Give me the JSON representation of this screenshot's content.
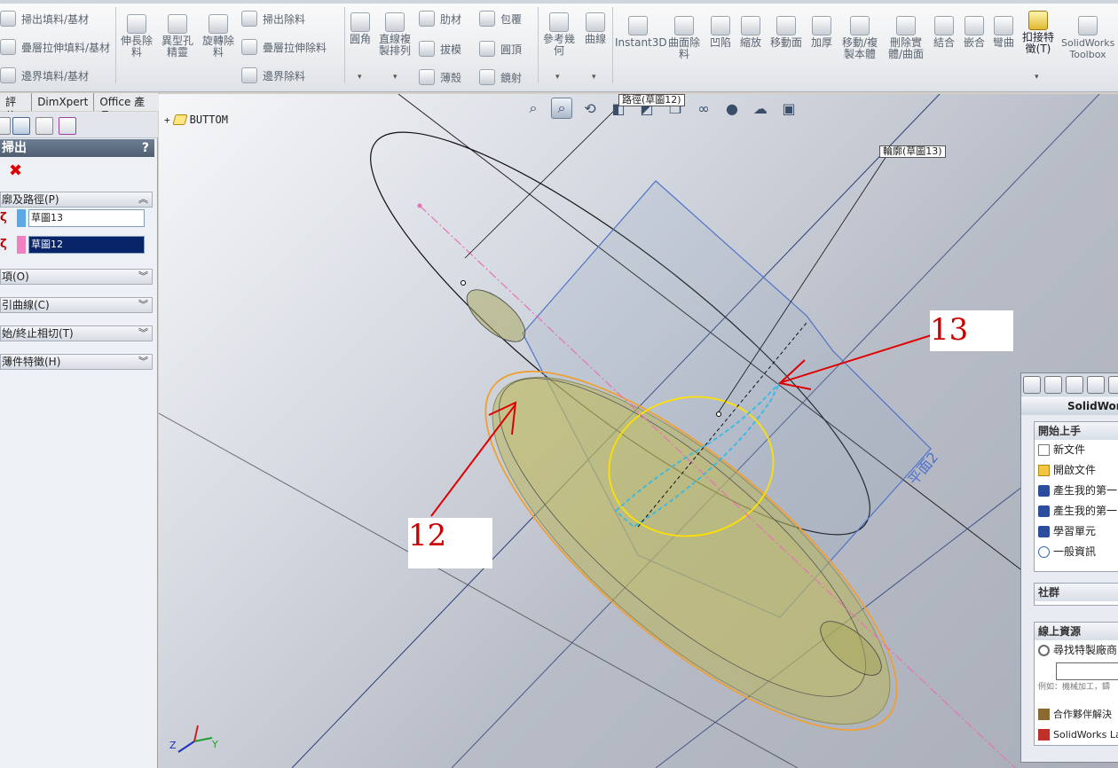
{
  "ribbon": {
    "sweep_boss": "掃出填料/基材",
    "loft_boss": "疊層拉伸填料/基材",
    "boundary_boss": "邊界填料/基材",
    "extrude_cut": "伸長除料",
    "hole_wizard": "異型孔精靈",
    "revolve_cut": "旋轉除料",
    "sweep_cut": "掃出除料",
    "loft_cut": "疊層拉伸除料",
    "boundary_cut": "邊界除料",
    "fillet": "圓角",
    "linear_pattern": "直線複製排列",
    "rib": "肋材",
    "draft": "拔模",
    "shell": "薄殼",
    "wrap": "包覆",
    "dome": "圓頂",
    "mirror": "鏡射",
    "reference_geometry": "參考幾何",
    "curves": "曲線",
    "instant3d": "Instant3D",
    "surface_cut": "曲面除料",
    "indent": "凹陷",
    "scale": "縮放",
    "move_face": "移動面",
    "thicken": "加厚",
    "move_copy_body": "移動/複製本體",
    "delete_body": "刪除實體/曲面",
    "combine": "結合",
    "intersect": "嵌合",
    "flex": "彎曲",
    "fastening_feature": "扣接特徵(T)",
    "toolbox": "SolidWorks Toolbox"
  },
  "tabs": [
    "評估",
    "DimXpert",
    "Office 產品"
  ],
  "property_manager": {
    "title": "掃出",
    "help": "?",
    "section_profile_path": "廓及路徑(P)",
    "profile_value": "草圖13",
    "path_value": "草圖12",
    "section_options": "項(O)",
    "section_guide_curves": "引曲線(C)",
    "section_start_end_tangency": "始/終止相切(T)",
    "section_thin_feature": "薄件特徵(H)"
  },
  "viewport": {
    "tree_node": "BUTTOM",
    "callout_path": "路徑(草圖12)",
    "callout_profile": "輪廓(草圖13)",
    "plane_label": "平面2",
    "annotation_13": "13",
    "annotation_12": "12",
    "triad_z": "Z",
    "triad_y": "Y"
  },
  "task_pane": {
    "title": "SolidWorks",
    "group_getting_started": "開始上手",
    "new_document": "新文件",
    "open_document": "開啟文件",
    "create_first_1": "產生我的第一",
    "create_first_2": "產生我的第一",
    "tutorials": "學習單元",
    "general_info": "一般資訊",
    "group_community": "社群",
    "group_online": "線上資源",
    "find_vendor": "尋找特製廠商",
    "search_hint": "例如：機械加工，鑄",
    "partner_solutions": "合作夥伴解決",
    "solidworks_labs": "SolidWorks La"
  },
  "colors": {
    "annotation_red": "#cc0000",
    "selection_navy": "#0a246a",
    "profile_swatch": "#5aa8e8",
    "path_swatch": "#f080c0",
    "preview_body": "#b9b45a"
  }
}
